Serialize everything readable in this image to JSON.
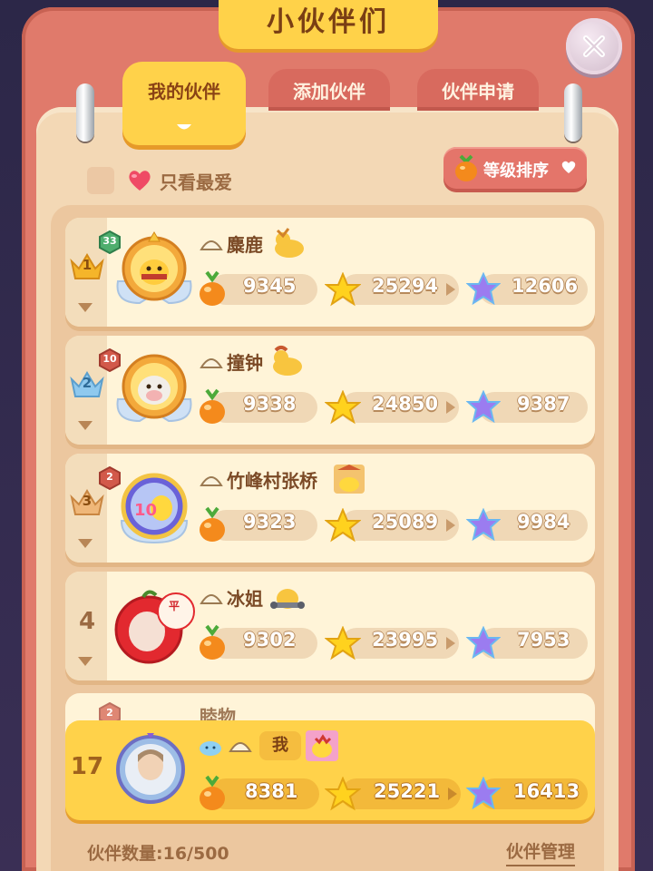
{
  "title": "小伙伴们",
  "tabs": [
    {
      "label": "我的伙伴",
      "active": true
    },
    {
      "label": "添加伙伴",
      "active": false
    },
    {
      "label": "伙伴申请",
      "active": false
    }
  ],
  "filter": {
    "favorites_label": "只看最爱",
    "sort_label": "等级排序"
  },
  "partners": [
    {
      "rank": "1",
      "level": "33",
      "name": "麋鹿",
      "fruit": "9345",
      "star": "25294",
      "rainbow": "12606"
    },
    {
      "rank": "2",
      "level": "10",
      "name": "撞钟",
      "fruit": "9338",
      "star": "24850",
      "rainbow": "9387"
    },
    {
      "rank": "3",
      "level": "2",
      "name": "竹峰村张桥",
      "fruit": "9323",
      "star": "25089",
      "rainbow": "9984"
    },
    {
      "rank": "4",
      "name": "冰姐",
      "fruit": "9302",
      "star": "23995",
      "rainbow": "7953"
    }
  ],
  "peek_partner": {
    "level": "2",
    "name": "睦物"
  },
  "self": {
    "rank": "17",
    "tag": "我",
    "fruit": "8381",
    "star": "25221",
    "rainbow": "16413"
  },
  "footer": {
    "count_label": "伙伴数量:16/500",
    "manage_label": "伙伴管理"
  },
  "colors": {
    "frame": "#e07a6b",
    "tab_active": "#ffd24a",
    "card": "#fff4d8",
    "self_card": "#ffd24a"
  },
  "icons": [
    "close-icon",
    "heart-icon",
    "fruit-icon",
    "star-icon",
    "rainbow-star-icon",
    "crown-icon",
    "dumpling-icon",
    "chevron-down-icon"
  ]
}
